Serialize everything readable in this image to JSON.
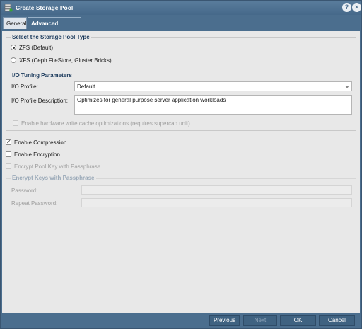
{
  "window": {
    "title": "Create Storage Pool",
    "help_icon": "?",
    "close_icon": "×"
  },
  "tabs": [
    {
      "label": "General",
      "active": false
    },
    {
      "label": "Advanced Settings",
      "active": true
    }
  ],
  "pool_type": {
    "legend": "Select the Storage Pool Type",
    "options": [
      {
        "label": "ZFS (Default)",
        "selected": true
      },
      {
        "label": "XFS (Ceph FileStore, Gluster Bricks)",
        "selected": false
      }
    ]
  },
  "io_tuning": {
    "legend": "I/O Tuning Parameters",
    "profile_label": "I/O Profile:",
    "profile_value": "Default",
    "description_label": "I/O Profile Description:",
    "description_value": "Optimizes for general purpose server application workloads",
    "cache_checkbox_label": "Enable hardware write cache optimizations (requires supercap unit)"
  },
  "options": {
    "compression_label": "Enable Compression",
    "compression_checked": true,
    "encryption_label": "Enable Encryption",
    "encryption_checked": false,
    "passphrase_key_label": "Encrypt Pool Key with Passphrase"
  },
  "encrypt_keys": {
    "legend": "Encrypt Keys with Passphrase",
    "password_label": "Password:",
    "repeat_password_label": "Repeat Password:"
  },
  "footer": {
    "previous_label": "Previous",
    "next_label": "Next",
    "ok_label": "OK",
    "cancel_label": "Cancel"
  },
  "colors": {
    "accent": "#4b6e8e",
    "legend_text": "#1b3a5c",
    "panel_bg": "#e8e8e8"
  }
}
